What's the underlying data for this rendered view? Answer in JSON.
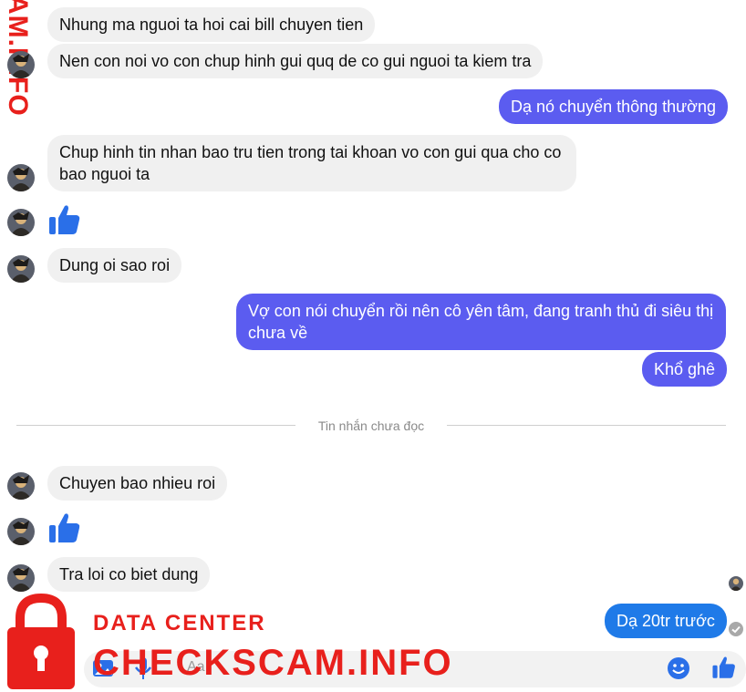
{
  "conversation": {
    "messages": [
      {
        "side": "in",
        "text": "Nhung ma nguoi ta hoi cai bill chuyen tien"
      },
      {
        "side": "in",
        "text": "Nen con noi vo con chup hinh gui quq de co gui nguoi ta kiem tra"
      },
      {
        "side": "out",
        "text": "Dạ nó chuyển thông thường"
      },
      {
        "side": "in",
        "text": "Chup hinh tin nhan bao tru tien trong tai khoan vo con gui qua cho co bao nguoi ta"
      },
      {
        "side": "in",
        "text": "Dung oi sao roi"
      },
      {
        "side": "out",
        "text": "Vợ con nói chuyển rồi nên cô yên tâm, đang tranh thủ đi siêu thị chưa về"
      },
      {
        "side": "out",
        "text": "Khổ ghê"
      },
      {
        "side": "in",
        "text": "Chuyen bao nhieu roi"
      },
      {
        "side": "in",
        "text": "Tra loi co biet dung"
      },
      {
        "side": "out",
        "text": "Dạ 20tr trước"
      }
    ],
    "unread_divider": "Tin nhắn chưa đọc"
  },
  "composer": {
    "placeholder": "Aa",
    "icons": [
      "image-icon",
      "mic-icon",
      "emoji-icon",
      "like-icon"
    ]
  },
  "watermark": {
    "side_text": "AM.INFO",
    "title": "DATA CENTER",
    "brand": "CHECKSCAM.INFO"
  },
  "colors": {
    "outgoing_bubble": "#5b5cf0",
    "outgoing_bubble_alt": "#1f7ae8",
    "incoming_bubble": "#f0f0f0",
    "like_blue": "#2a6fe8",
    "watermark_red": "#e8201c"
  }
}
